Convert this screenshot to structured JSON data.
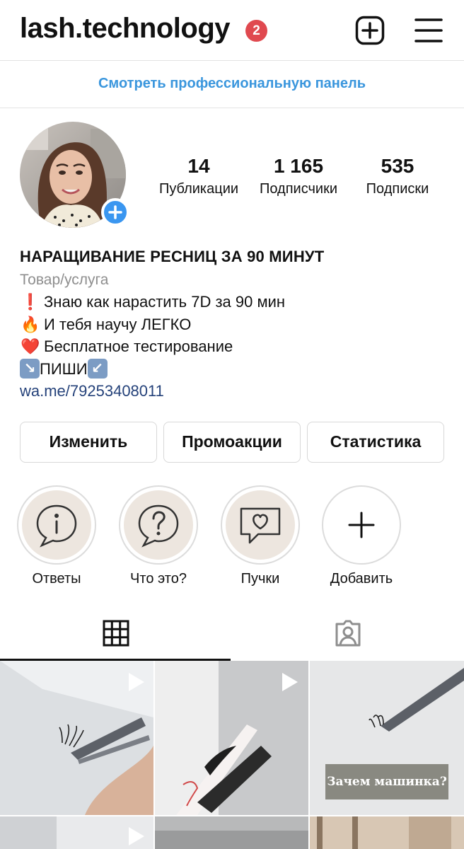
{
  "header": {
    "username": "lash.technology",
    "notification_count": "2",
    "icons": {
      "add": "plus-square-icon",
      "menu": "hamburger-menu-icon"
    }
  },
  "pro_panel": {
    "label": "Смотреть профессиональную панель",
    "color": "#3a96dd"
  },
  "profile": {
    "stats": [
      {
        "value": "14",
        "label": "Публикации"
      },
      {
        "value": "1 165",
        "label": "Подписчики"
      },
      {
        "value": "535",
        "label": "Подписки"
      }
    ]
  },
  "bio": {
    "name": "НАРАЩИВАНИЕ РЕСНИЦ ЗА 90 МИНУТ",
    "category": "Товар/услуга",
    "lines": [
      {
        "emoji": "❗",
        "text": "Знаю как нарастить 7D за 90 мин"
      },
      {
        "emoji": "🔥",
        "text": "И тебя научу ЛЕГКО"
      },
      {
        "emoji": "❤️",
        "text": "Бесплатное тестирование"
      }
    ],
    "cta": {
      "arrow_left": "↘",
      "text": "ПИШИ",
      "arrow_right": "↙"
    },
    "link": "wa.me/79253408011"
  },
  "actions": [
    {
      "label": "Изменить"
    },
    {
      "label": "Промоакции"
    },
    {
      "label": "Статистика"
    }
  ],
  "highlights": [
    {
      "label": "Ответы",
      "icon": "info-speech-bubble-icon"
    },
    {
      "label": "Что это?",
      "icon": "question-speech-bubble-icon"
    },
    {
      "label": "Пучки",
      "icon": "heart-speech-bubble-icon"
    },
    {
      "label": "Добавить",
      "icon": "plus-icon"
    }
  ],
  "tabs": [
    {
      "name": "grid",
      "icon": "grid-icon",
      "active": true
    },
    {
      "name": "tagged",
      "icon": "tagged-person-icon",
      "active": false
    }
  ],
  "posts": [
    {
      "type": "video",
      "caption": ""
    },
    {
      "type": "video",
      "caption": ""
    },
    {
      "type": "image",
      "caption": "Зачем машинка?"
    },
    {
      "type": "video",
      "caption": ""
    },
    {
      "type": "image",
      "caption": ""
    },
    {
      "type": "image",
      "caption": ""
    }
  ]
}
